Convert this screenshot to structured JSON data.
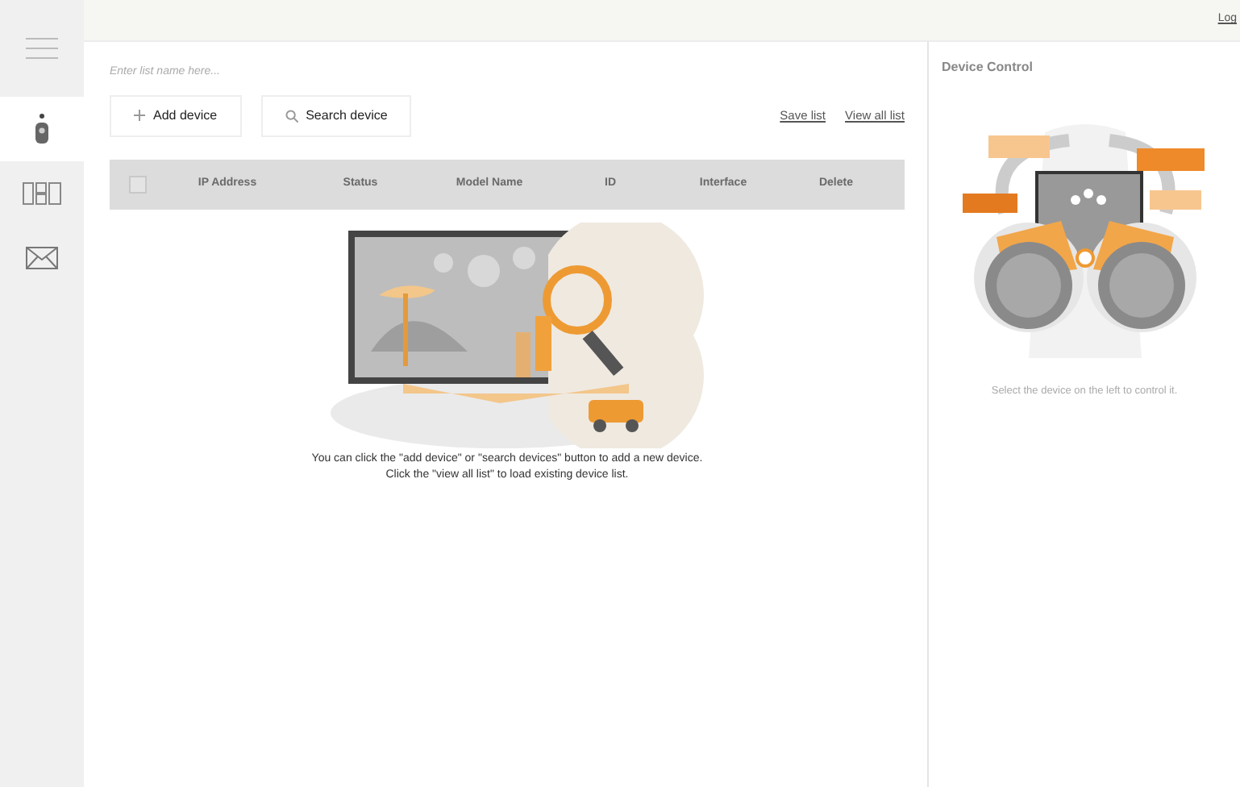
{
  "top_bar": {
    "login_link": "Log"
  },
  "sidebar": {
    "items": [
      {
        "kind": "remote",
        "selected": true
      },
      {
        "kind": "grid",
        "selected": false
      },
      {
        "kind": "mail",
        "selected": false
      }
    ]
  },
  "list_name": {
    "placeholder": "Enter list name here..."
  },
  "buttons": [
    {
      "kind": "add",
      "label": "Add device"
    },
    {
      "kind": "search",
      "label": "Search device"
    }
  ],
  "links": [
    "Save list",
    "View all list"
  ],
  "table": {
    "select_all_checked": false,
    "columns": [
      "IP Address",
      "Status",
      "Model Name",
      "ID",
      "Interface",
      "Delete"
    ]
  },
  "empty_message": [
    "You can click the \"add device\" or \"search devices\" button to add a new device.",
    "Click the \"view all list\" to load existing device list."
  ],
  "device_control": {
    "title": "Device Control",
    "hint": "Select the device on the left to control it."
  }
}
